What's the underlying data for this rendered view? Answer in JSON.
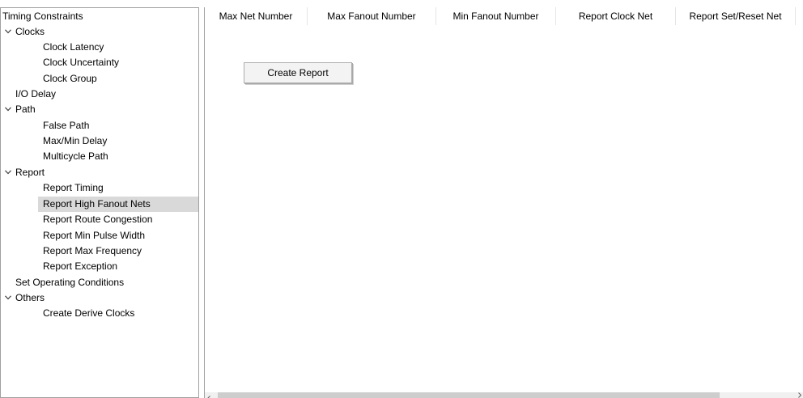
{
  "tree": {
    "items": [
      {
        "label": "Timing Constraints",
        "level": 0,
        "expandable": false,
        "selected": false
      },
      {
        "label": "Clocks",
        "level": 0,
        "expandable": true,
        "selected": false
      },
      {
        "label": "Clock Latency",
        "level": 2,
        "expandable": false,
        "selected": false
      },
      {
        "label": "Clock Uncertainty",
        "level": 2,
        "expandable": false,
        "selected": false
      },
      {
        "label": "Clock Group",
        "level": 2,
        "expandable": false,
        "selected": false
      },
      {
        "label": "I/O Delay",
        "level": 1,
        "expandable": false,
        "selected": false
      },
      {
        "label": "Path",
        "level": 0,
        "expandable": true,
        "selected": false
      },
      {
        "label": "False Path",
        "level": 2,
        "expandable": false,
        "selected": false
      },
      {
        "label": "Max/Min Delay",
        "level": 2,
        "expandable": false,
        "selected": false
      },
      {
        "label": "Multicycle Path",
        "level": 2,
        "expandable": false,
        "selected": false
      },
      {
        "label": "Report",
        "level": 0,
        "expandable": true,
        "selected": false
      },
      {
        "label": "Report Timing",
        "level": 2,
        "expandable": false,
        "selected": false
      },
      {
        "label": "Report High Fanout Nets",
        "level": 2,
        "expandable": false,
        "selected": true
      },
      {
        "label": "Report Route Congestion",
        "level": 2,
        "expandable": false,
        "selected": false
      },
      {
        "label": "Report Min Pulse Width",
        "level": 2,
        "expandable": false,
        "selected": false
      },
      {
        "label": "Report Max Frequency",
        "level": 2,
        "expandable": false,
        "selected": false
      },
      {
        "label": "Report Exception",
        "level": 2,
        "expandable": false,
        "selected": false
      },
      {
        "label": "Set Operating Conditions",
        "level": 1,
        "expandable": false,
        "selected": false
      },
      {
        "label": "Others",
        "level": 0,
        "expandable": true,
        "selected": false
      },
      {
        "label": "Create Derive Clocks",
        "level": 2,
        "expandable": false,
        "selected": false
      }
    ]
  },
  "table": {
    "columns": [
      "Max Net Number",
      "Max Fanout Number",
      "Min Fanout Number",
      "Report Clock Net",
      "Report Set/Reset Net"
    ]
  },
  "actions": {
    "create_report_label": "Create Report"
  },
  "colors": {
    "selection": "#d9d9d9",
    "border": "#a0a0a0",
    "scroll_thumb": "#cdcdcd"
  }
}
